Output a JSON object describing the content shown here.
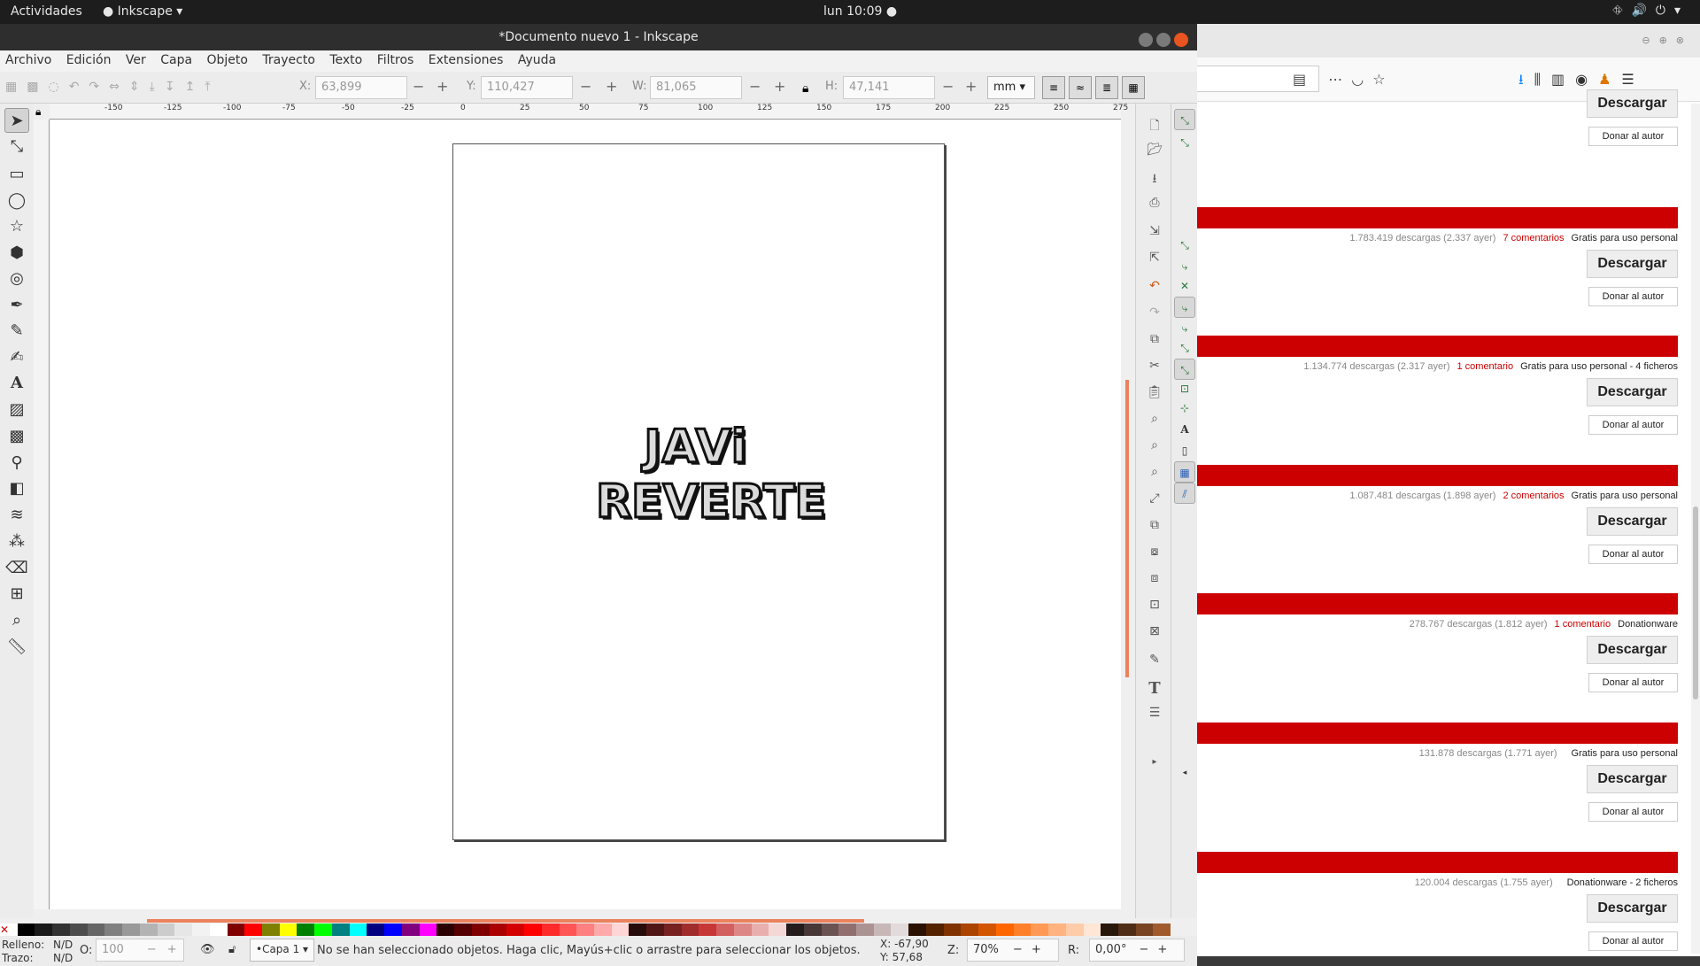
{
  "topbar": {
    "activities": "Actividades",
    "app": "Inkscape",
    "clock": "lun 10:09"
  },
  "window": {
    "title": "*Documento nuevo 1 - Inkscape"
  },
  "menu": [
    "Archivo",
    "Edición",
    "Ver",
    "Capa",
    "Objeto",
    "Trayecto",
    "Texto",
    "Filtros",
    "Extensiones",
    "Ayuda"
  ],
  "controls": {
    "x_label": "X:",
    "x_value": "63,899",
    "y_label": "Y:",
    "y_value": "110,427",
    "w_label": "W:",
    "w_value": "81,065",
    "h_label": "H:",
    "h_value": "47,141",
    "unit": "mm"
  },
  "ruler_labels": [
    "-150",
    "-125",
    "-100",
    "-75",
    "-50",
    "-25",
    "0",
    "25",
    "50",
    "75",
    "100",
    "125",
    "150",
    "175",
    "200",
    "225",
    "250",
    "275"
  ],
  "artwork": {
    "line1": "JAVi",
    "line2": "REVERTE"
  },
  "palette": [
    "#000000",
    "#1a1a1a",
    "#333333",
    "#4d4d4d",
    "#666666",
    "#808080",
    "#999999",
    "#b3b3b3",
    "#cccccc",
    "#e6e6e6",
    "#f2f2f2",
    "#ffffff",
    "#800000",
    "#ff0000",
    "#808000",
    "#ffff00",
    "#008000",
    "#00ff00",
    "#008080",
    "#00ffff",
    "#000080",
    "#0000ff",
    "#800080",
    "#ff00ff",
    "#2b0000",
    "#550000",
    "#800000",
    "#aa0000",
    "#d40000",
    "#ff0000",
    "#ff2a2a",
    "#ff5555",
    "#ff8080",
    "#ffaaaa",
    "#ffd5d5",
    "#280b0b",
    "#501616",
    "#782121",
    "#a02c2c",
    "#c83737",
    "#d35f5f",
    "#de8787",
    "#e9afaf",
    "#f4d7d7",
    "#241c1c",
    "#483737",
    "#6c5353",
    "#916f6f",
    "#ac9393",
    "#c8b7b7",
    "#e3dbdb",
    "#2b1100",
    "#552200",
    "#803300",
    "#aa4400",
    "#d45500",
    "#ff6600",
    "#ff7f2a",
    "#ff9955",
    "#ffb380",
    "#ffccaa",
    "#ffe6d5",
    "#28170b",
    "#502d16",
    "#784421",
    "#a05a2c"
  ],
  "status": {
    "fill_label": "Relleno:",
    "fill_value": "N/D",
    "stroke_label": "Trazo:",
    "stroke_value": "N/D",
    "opacity_label": "O:",
    "opacity_value": "100",
    "layer": "•Capa 1",
    "message": "No se han seleccionado objetos. Haga clic, Mayús+clic o arrastre para seleccionar los objetos.",
    "x_coord": "X: -67,90",
    "y_coord": "Y: 57,68",
    "zoom_label": "Z:",
    "zoom_value": "70%",
    "rot_label": "R:",
    "rot_value": "0,00°"
  },
  "browser": {
    "downloads": [
      {
        "stats": "",
        "comments": "",
        "license": "",
        "has_bar": false
      },
      {
        "stats": "1.783.419 descargas (2.337 ayer)",
        "comments": "7 comentarios",
        "license": "Gratis para uso personal",
        "has_bar": true
      },
      {
        "stats": "1.134.774 descargas (2.317 ayer)",
        "comments": "1 comentario",
        "license": "Gratis para uso personal - 4 ficheros",
        "has_bar": true
      },
      {
        "stats": "1.087.481 descargas (1.898 ayer)",
        "comments": "2 comentarios",
        "license": "Gratis para uso personal",
        "has_bar": true
      },
      {
        "stats": "278.767 descargas (1.812 ayer)",
        "comments": "1 comentario",
        "license": "Donationware",
        "has_bar": true
      },
      {
        "stats": "131.878 descargas (1.771 ayer)",
        "comments": "",
        "license": "Gratis para uso personal",
        "has_bar": true
      },
      {
        "stats": "120.004 descargas (1.755 ayer)",
        "comments": "",
        "license": "Donationware - 2 ficheros",
        "has_bar": true
      }
    ],
    "download_label": "Descargar",
    "donate_label": "Donar al autor"
  }
}
